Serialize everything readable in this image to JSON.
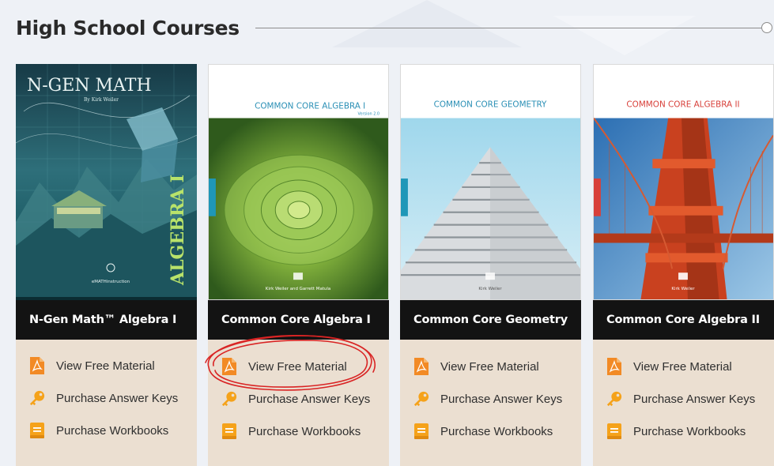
{
  "section": {
    "title": "High School Courses"
  },
  "colors": {
    "pdf_icon": "#f28a25",
    "key_icon": "#f5a21a",
    "book_icon": "#f5a21a",
    "title_bar": "#131313",
    "link_panel": "#ebdfd1",
    "annotation": "#d92424"
  },
  "courses": [
    {
      "cover": {
        "title": "N-GEN MATH",
        "subtitle": "By Kirk Weiler",
        "spine": "ALGEBRA I",
        "publisher": "eMATHinstruction"
      },
      "name": "N-Gen Math™ Algebra I",
      "links": [
        {
          "label": "View Free Material",
          "icon": "pdf-icon"
        },
        {
          "label": "Purchase Answer Keys",
          "icon": "key-icon"
        },
        {
          "label": "Purchase Workbooks",
          "icon": "book-icon"
        }
      ]
    },
    {
      "cover": {
        "title": "COMMON CORE ALGEBRA I",
        "version": "Version 2.0",
        "authors": "Kirk Weiler and Garrett Matula",
        "title_color": "#2a8fb5"
      },
      "name": "Common Core Algebra I",
      "links": [
        {
          "label": "View Free Material",
          "icon": "pdf-icon"
        },
        {
          "label": "Purchase Answer Keys",
          "icon": "key-icon"
        },
        {
          "label": "Purchase Workbooks",
          "icon": "book-icon"
        }
      ]
    },
    {
      "cover": {
        "title": "COMMON CORE GEOMETRY",
        "authors": "Kirk Weiler",
        "title_color": "#2a8fb5"
      },
      "name": "Common Core Geometry",
      "links": [
        {
          "label": "View Free Material",
          "icon": "pdf-icon"
        },
        {
          "label": "Purchase Answer Keys",
          "icon": "key-icon"
        },
        {
          "label": "Purchase Workbooks",
          "icon": "book-icon"
        }
      ]
    },
    {
      "cover": {
        "title": "COMMON CORE ALGEBRA II",
        "authors": "Kirk Weiler",
        "title_color": "#d8403a"
      },
      "name": "Common Core Algebra II",
      "links": [
        {
          "label": "View Free Material",
          "icon": "pdf-icon"
        },
        {
          "label": "Purchase Answer Keys",
          "icon": "key-icon"
        },
        {
          "label": "Purchase Workbooks",
          "icon": "book-icon"
        }
      ]
    }
  ]
}
